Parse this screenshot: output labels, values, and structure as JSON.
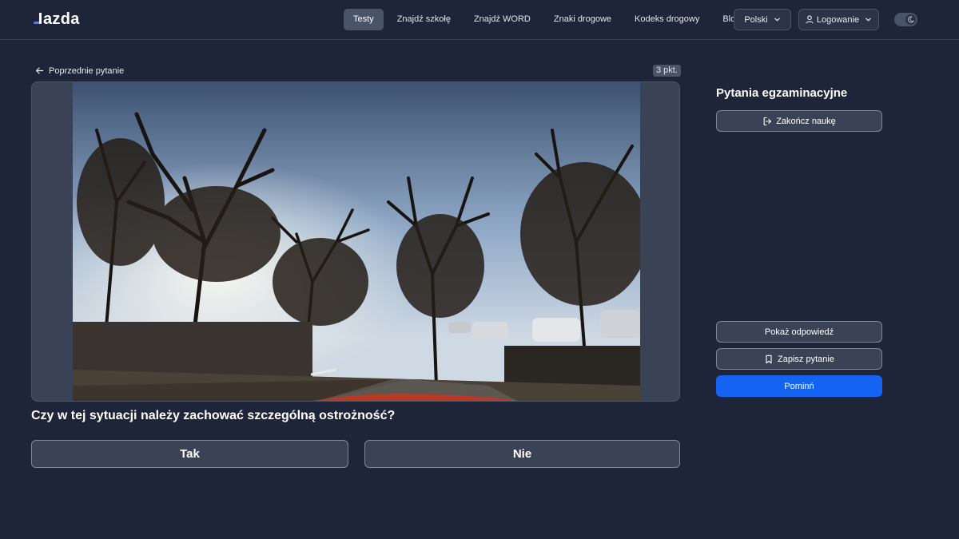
{
  "brand": {
    "logo_text": "azda",
    "accent_color": "#4f7ff2"
  },
  "nav": {
    "items": [
      {
        "label": "Testy",
        "active": true
      },
      {
        "label": "Znajdź szkołę",
        "active": false
      },
      {
        "label": "Znajdź WORD",
        "active": false
      },
      {
        "label": "Znaki drogowe",
        "active": false
      },
      {
        "label": "Kodeks drogowy",
        "active": false
      },
      {
        "label": "Blog",
        "active": false
      }
    ],
    "language": "Polski",
    "login": "Logowanie",
    "theme_toggle_icon": "moon-icon"
  },
  "question": {
    "prev_label": "Poprzednie pytanie",
    "points": "3 pkt.",
    "text": "Czy w tej sytuacji należy zachować szczególną ostrożność?",
    "answers": [
      "Tak",
      "Nie"
    ]
  },
  "sidebar": {
    "title": "Pytania egzaminacyjne",
    "finish_label": "Zakończ naukę",
    "show_answer_label": "Pokaż odpowiedź",
    "save_label": "Zapisz pytanie",
    "skip_label": "Pominń",
    "primary_color": "#1463f3"
  }
}
